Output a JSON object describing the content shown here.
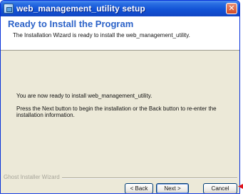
{
  "window": {
    "title": "web_management_utility setup",
    "close_glyph": "✕"
  },
  "header": {
    "title": "Ready to Install the Program",
    "subtitle": "The Installation Wizard is ready to install the web_management_utility."
  },
  "body": {
    "message_ready": "You are now ready to install web_management_utility.",
    "message_instructions": "Press the Next button to begin the installation or the Back button to re-enter the installation information."
  },
  "footer": {
    "brand": "Ghost Installer Wizard"
  },
  "buttons": {
    "back": "< Back",
    "next": "Next >",
    "cancel": "Cancel"
  },
  "colors": {
    "title_accent": "#2b62c8",
    "titlebar": "#1353d6",
    "dialog_bg": "#ece9d8",
    "close_button": "#d34b24",
    "pointer": "#e0141c"
  },
  "icons": {
    "app": "installer-icon",
    "close": "close-icon",
    "pointer": "red-arrow-icon"
  }
}
